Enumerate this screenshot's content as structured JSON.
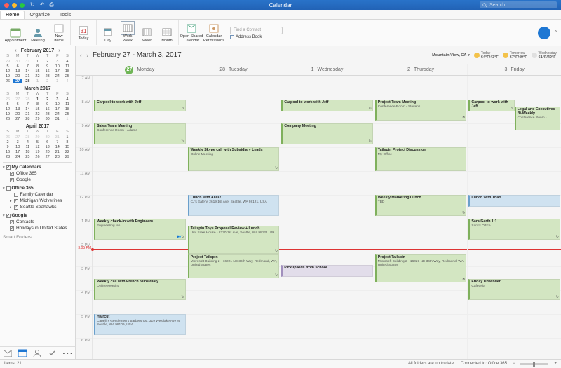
{
  "window": {
    "title": "Calendar",
    "search_placeholder": "Search"
  },
  "tabs": {
    "home": "Home",
    "organize": "Organize",
    "tools": "Tools"
  },
  "ribbon": {
    "appointment": "Appointment",
    "meeting": "Meeting",
    "new_items": "New\nItems",
    "today": "Today",
    "day": "Day",
    "work_week": "Work\nWeek",
    "week": "Week",
    "month": "Month",
    "open_shared": "Open Shared\nCalendar",
    "permissions": "Calendar\nPermissions",
    "find_contact": "Find a Contact",
    "address_book": "Address Book"
  },
  "minicals": {
    "feb": {
      "title": "February 2017",
      "dow": [
        "S",
        "M",
        "T",
        "W",
        "T",
        "F",
        "S"
      ],
      "rows": [
        [
          "29",
          "30",
          "31",
          "1",
          "2",
          "3",
          "4"
        ],
        [
          "5",
          "6",
          "7",
          "8",
          "9",
          "10",
          "11"
        ],
        [
          "12",
          "13",
          "14",
          "15",
          "16",
          "17",
          "18"
        ],
        [
          "19",
          "20",
          "21",
          "22",
          "23",
          "24",
          "25"
        ],
        [
          "26",
          "27",
          "28",
          "1",
          "2",
          "3",
          "4"
        ]
      ]
    },
    "mar": {
      "title": "March 2017",
      "rows": [
        [
          "26",
          "27",
          "28",
          "1",
          "2",
          "3",
          "4"
        ],
        [
          "5",
          "6",
          "7",
          "8",
          "9",
          "10",
          "11"
        ],
        [
          "12",
          "13",
          "14",
          "15",
          "16",
          "17",
          "18"
        ],
        [
          "19",
          "20",
          "21",
          "22",
          "23",
          "24",
          "25"
        ],
        [
          "26",
          "27",
          "28",
          "29",
          "30",
          "31",
          "1"
        ]
      ]
    },
    "apr": {
      "title": "April 2017",
      "rows": [
        [
          "26",
          "27",
          "28",
          "29",
          "30",
          "31",
          "1"
        ],
        [
          "2",
          "3",
          "4",
          "5",
          "6",
          "7",
          "8"
        ],
        [
          "9",
          "10",
          "11",
          "12",
          "13",
          "14",
          "15"
        ],
        [
          "16",
          "17",
          "18",
          "19",
          "20",
          "21",
          "22"
        ],
        [
          "23",
          "24",
          "25",
          "26",
          "27",
          "28",
          "29"
        ]
      ]
    }
  },
  "calendars": {
    "my": "My Calendars",
    "my_items": {
      "o365": "Office 365",
      "google": "Google"
    },
    "o365_group": "Office 365",
    "o365_items": {
      "family": "Family Calendar",
      "mich": "Michigan Wolverines",
      "sea": "Seattle Seahawks"
    },
    "google_group": "Google",
    "google_items": {
      "contacts": "Contacts",
      "holidays": "Holidays in United States"
    },
    "smart": "Smart Folders"
  },
  "header": {
    "range": "February 27 - March 3, 2017",
    "location": "Mountain View, CA",
    "today_lbl": "Today",
    "today_tmp": "64°F/43°F",
    "tomorrow_lbl": "Tomorrow",
    "tomorrow_tmp": "67°F/49°F",
    "wed_lbl": "Wednesday",
    "wed_tmp": "61°F/49°F"
  },
  "days": {
    "d0n": "27",
    "d0l": "Monday",
    "d1n": "28",
    "d1l": "Tuesday",
    "d2n": "1",
    "d2l": "Wednesday",
    "d3n": "2",
    "d3l": "Thursday",
    "d4n": "3",
    "d4l": "Friday"
  },
  "hours": [
    "7 AM",
    "8 AM",
    "9 AM",
    "10 AM",
    "11 AM",
    "12 PM",
    "1 PM",
    "2 PM",
    "3 PM",
    "4 PM",
    "5 PM",
    "6 PM"
  ],
  "now": "3:05 PM",
  "events": {
    "mon_carpool": {
      "t": "Carpool to work with Jeff",
      "s": ""
    },
    "mon_sales": {
      "t": "Sales Team Meeting",
      "s": "Conference Room - Adams"
    },
    "mon_eng": {
      "t": "Weekly check-in with Engineers",
      "s": "Engineering lab"
    },
    "mon_french": {
      "t": "Weekly call with French Subsidiary",
      "s": "Online Meeting"
    },
    "mon_haircut": {
      "t": "Haircut",
      "s": "Capelli's Gentlemen's Barbershop, 319 Westlake Ave N, Seattle, WA 98109, USA"
    },
    "tue_skype": {
      "t": "Weekly Skype call with Subsidiary Leads",
      "s": "Online Meeting"
    },
    "tue_lunch": {
      "t": "Lunch with Alice!",
      "s": "CJ's Eatery, 2619 1st Ave, Seattle, WA 98121, USA"
    },
    "tue_review": {
      "t": "Tailspin Toys Proposal Review + Lunch",
      "s": "Umi Sake House - 2230 1st Ave, Seattle, WA 98121 USł"
    },
    "tue_project": {
      "t": "Project Tailspin",
      "s": "Microsoft Building 2 - 16021 NE 36th Way, Redmond, WA, United States"
    },
    "wed_carpool": {
      "t": "Carpool to work with Jeff",
      "s": ""
    },
    "wed_company": {
      "t": "Company Meeting",
      "s": ""
    },
    "wed_pickup": {
      "t": "Pickup kids from school",
      "s": ""
    },
    "thu_team": {
      "t": "Project Team Meeting",
      "s": "Conference Room - Stevens"
    },
    "thu_disc": {
      "t": "Tailspin Project Discussion",
      "s": "My Office"
    },
    "thu_market": {
      "t": "Weekly Marketing Lunch",
      "s": "TBD"
    },
    "thu_project": {
      "t": "Project Tailspin",
      "s": "Microsoft Building 2 - 16021 NE 36th Way, Redmond, WA, United States"
    },
    "fri_carpool": {
      "t": "Carpool to work with Jeff",
      "s": ""
    },
    "fri_legal": {
      "t": "Legal and Executives Bi-Weekly",
      "s": "Conference Room -"
    },
    "fri_thao": {
      "t": "Lunch with Thao",
      "s": ""
    },
    "fri_sara": {
      "t": "Sara/Garth 1:1",
      "s": "Sara's Office"
    },
    "fri_unwind": {
      "t": "Friday Unwinder",
      "s": "Cafeteria"
    }
  },
  "status": {
    "items": "Items: 21",
    "sync": "All folders are up to date.",
    "conn": "Connected to: Office 365"
  }
}
